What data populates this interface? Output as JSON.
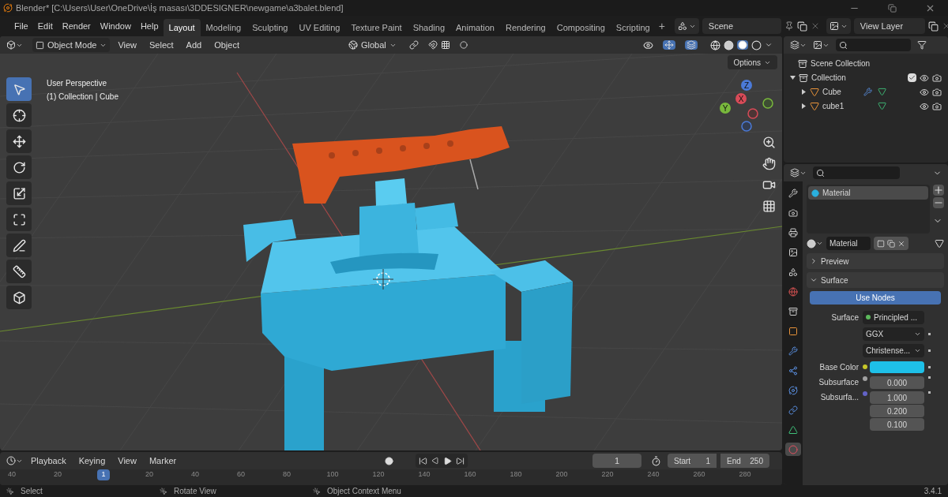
{
  "window": {
    "title": "Blender* [C:\\Users\\User\\OneDrive\\İş masası\\3DDESIGNER\\newgame\\a3balet.blend]"
  },
  "menu": [
    "File",
    "Edit",
    "Render",
    "Window",
    "Help"
  ],
  "workspaces": [
    {
      "label": "Layout",
      "selected": true
    },
    {
      "label": "Modeling",
      "selected": false
    },
    {
      "label": "Sculpting",
      "selected": false
    },
    {
      "label": "UV Editing",
      "selected": false
    },
    {
      "label": "Texture Paint",
      "selected": false
    },
    {
      "label": "Shading",
      "selected": false
    },
    {
      "label": "Animation",
      "selected": false
    },
    {
      "label": "Rendering",
      "selected": false
    },
    {
      "label": "Compositing",
      "selected": false
    },
    {
      "label": "Scripting",
      "selected": false
    }
  ],
  "add_workspace": "+",
  "scene": "Scene",
  "view_layer": "View Layer",
  "viewport_header": {
    "mode": "Object Mode",
    "menus": [
      "View",
      "Select",
      "Add",
      "Object"
    ],
    "orientation": "Global",
    "options": "Options"
  },
  "viewport": {
    "perspective": "User Perspective",
    "context": "(1) Collection | Cube",
    "gizmo": [
      "Z",
      "X",
      "Y"
    ],
    "tools": [
      {
        "kind": "select",
        "selected": true
      },
      {
        "kind": "cursor",
        "selected": false
      },
      {
        "kind": "move",
        "selected": false
      },
      {
        "kind": "rotate",
        "selected": false
      },
      {
        "kind": "scale",
        "selected": false
      },
      {
        "kind": "transform",
        "selected": false
      },
      {
        "kind": "annotate",
        "selected": false
      },
      {
        "kind": "measure",
        "selected": false
      },
      {
        "kind": "add-cube",
        "selected": false
      }
    ]
  },
  "outliner": {
    "root": "Scene Collection",
    "items": [
      {
        "name": "Collection",
        "expanded": true,
        "checked": true,
        "children": [
          {
            "name": "Cube",
            "expanded": false,
            "modifier": true
          },
          {
            "name": "cube1",
            "expanded": false,
            "modifier": false
          }
        ]
      }
    ]
  },
  "properties": {
    "tabs": [
      {
        "kind": "tool",
        "selected": false
      },
      {
        "kind": "render",
        "selected": false
      },
      {
        "kind": "output",
        "selected": false
      },
      {
        "kind": "view-layer",
        "selected": false
      },
      {
        "kind": "scene",
        "selected": false
      },
      {
        "kind": "world",
        "selected": false
      },
      {
        "kind": "collection",
        "selected": false
      },
      {
        "kind": "object",
        "selected": false
      },
      {
        "kind": "modifier",
        "selected": false
      },
      {
        "kind": "particles",
        "selected": false
      },
      {
        "kind": "physics",
        "selected": false
      },
      {
        "kind": "constraints",
        "selected": false
      },
      {
        "kind": "data",
        "selected": false
      },
      {
        "kind": "material",
        "selected": true
      }
    ],
    "slots": [
      {
        "name": "Material",
        "selected": true
      }
    ],
    "material": "Material",
    "panels": [
      {
        "title": "Preview",
        "expanded": false
      },
      {
        "title": "Surface",
        "expanded": true
      }
    ],
    "use_nodes": "Use Nodes",
    "fields": [
      {
        "kind": "link",
        "label": "Surface",
        "value": "Principled ...",
        "color": "#5cb85c"
      },
      {
        "kind": "dropdown",
        "value": "GGX"
      },
      {
        "kind": "dropdown",
        "value": "Christense..."
      },
      {
        "kind": "swatch",
        "label": "Base Color",
        "color": "#c7c729",
        "value": {
          "color": "#1ec0e8"
        }
      },
      {
        "kind": "number",
        "label": "Subsurface",
        "color": "#a1a1a1",
        "values": [
          "0.000"
        ]
      },
      {
        "kind": "vector",
        "label": "Subsurfa...",
        "color": "#6363c7",
        "values": [
          "1.000",
          "0.200",
          "0.100"
        ]
      }
    ]
  },
  "timeline": {
    "menus": [
      "Playback",
      "Keying",
      "View",
      "Marker"
    ],
    "current": "1",
    "start_label": "Start",
    "start": "1",
    "end_label": "End",
    "end": "250",
    "ticks": [
      {
        "label": "40",
        "selected": false
      },
      {
        "label": "20",
        "selected": false
      },
      {
        "label": "1",
        "selected": true
      },
      {
        "label": "20",
        "selected": false
      },
      {
        "label": "40",
        "selected": false
      },
      {
        "label": "60",
        "selected": false
      },
      {
        "label": "80",
        "selected": false
      },
      {
        "label": "100",
        "selected": false
      },
      {
        "label": "120",
        "selected": false
      },
      {
        "label": "140",
        "selected": false
      },
      {
        "label": "160",
        "selected": false
      },
      {
        "label": "180",
        "selected": false
      },
      {
        "label": "200",
        "selected": false
      },
      {
        "label": "220",
        "selected": false
      },
      {
        "label": "240",
        "selected": false
      },
      {
        "label": "260",
        "selected": false
      },
      {
        "label": "280",
        "selected": false
      }
    ]
  },
  "status": {
    "hints": [
      "Select",
      "Rotate View",
      "Object Context Menu"
    ],
    "version": "3.4.1"
  }
}
